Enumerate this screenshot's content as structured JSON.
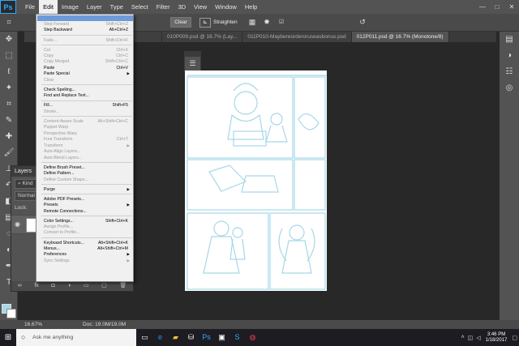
{
  "app": {
    "logo": "Ps"
  },
  "menubar": {
    "items": [
      "File",
      "Edit",
      "Image",
      "Layer",
      "Type",
      "Select",
      "Filter",
      "3D",
      "View",
      "Window",
      "Help"
    ],
    "active": "Edit",
    "window_controls": [
      "—",
      "□",
      "✕"
    ]
  },
  "options_bar": {
    "clear_label": "Clear",
    "straighten_label": "Straighten"
  },
  "tabs": [
    {
      "label": "010P009.psd @ 16.7% (Lay...",
      "active": false
    },
    {
      "label": "011P010-Maybereorderoruseasbonus.psd",
      "active": false
    },
    {
      "label": "012P011.psd @ 16.7% (Monotone/8)",
      "active": true
    }
  ],
  "edit_menu": {
    "items": [
      {
        "label": "",
        "shortcut": "",
        "disabled": false,
        "highlighted": true
      },
      {
        "label": "Step Forward",
        "shortcut": "Shift+Ctrl+Z",
        "disabled": true
      },
      {
        "label": "Step Backward",
        "shortcut": "Alt+Ctrl+Z",
        "disabled": false
      },
      {
        "sep": true
      },
      {
        "label": "Fade...",
        "shortcut": "Shift+Ctrl+F",
        "disabled": true
      },
      {
        "sep": true
      },
      {
        "label": "Cut",
        "shortcut": "Ctrl+X",
        "disabled": true
      },
      {
        "label": "Copy",
        "shortcut": "Ctrl+C",
        "disabled": true
      },
      {
        "label": "Copy Merged",
        "shortcut": "Shift+Ctrl+C",
        "disabled": true
      },
      {
        "label": "Paste",
        "shortcut": "Ctrl+V",
        "disabled": false
      },
      {
        "label": "Paste Special",
        "shortcut": "",
        "disabled": false,
        "submenu": true
      },
      {
        "label": "Clear",
        "shortcut": "",
        "disabled": true
      },
      {
        "sep": true
      },
      {
        "label": "Check Spelling...",
        "shortcut": "",
        "disabled": false
      },
      {
        "label": "Find and Replace Text...",
        "shortcut": "",
        "disabled": false
      },
      {
        "sep": true
      },
      {
        "label": "Fill...",
        "shortcut": "Shift+F5",
        "disabled": false
      },
      {
        "label": "Stroke...",
        "shortcut": "",
        "disabled": true
      },
      {
        "sep": true
      },
      {
        "label": "Content-Aware Scale",
        "shortcut": "Alt+Shift+Ctrl+C",
        "disabled": true
      },
      {
        "label": "Puppet Warp",
        "shortcut": "",
        "disabled": true
      },
      {
        "label": "Perspective Warp",
        "shortcut": "",
        "disabled": true
      },
      {
        "label": "Free Transform",
        "shortcut": "Ctrl+T",
        "disabled": true
      },
      {
        "label": "Transform",
        "shortcut": "",
        "disabled": true,
        "submenu": true
      },
      {
        "label": "Auto-Align Layers...",
        "shortcut": "",
        "disabled": true
      },
      {
        "label": "Auto-Blend Layers...",
        "shortcut": "",
        "disabled": true
      },
      {
        "sep": true
      },
      {
        "label": "Define Brush Preset...",
        "shortcut": "",
        "disabled": false
      },
      {
        "label": "Define Pattern...",
        "shortcut": "",
        "disabled": false
      },
      {
        "label": "Define Custom Shape...",
        "shortcut": "",
        "disabled": true
      },
      {
        "sep": true
      },
      {
        "label": "Purge",
        "shortcut": "",
        "disabled": false,
        "submenu": true
      },
      {
        "sep": true
      },
      {
        "label": "Adobe PDF Presets...",
        "shortcut": "",
        "disabled": false
      },
      {
        "label": "Presets",
        "shortcut": "",
        "disabled": false,
        "submenu": true
      },
      {
        "label": "Remote Connections...",
        "shortcut": "",
        "disabled": false
      },
      {
        "sep": true
      },
      {
        "label": "Color Settings...",
        "shortcut": "Shift+Ctrl+K",
        "disabled": false
      },
      {
        "label": "Assign Profile...",
        "shortcut": "",
        "disabled": true
      },
      {
        "label": "Convert to Profile...",
        "shortcut": "",
        "disabled": true
      },
      {
        "sep": true
      },
      {
        "label": "Keyboard Shortcuts...",
        "shortcut": "Alt+Shift+Ctrl+K",
        "disabled": false
      },
      {
        "label": "Menus...",
        "shortcut": "Alt+Shift+Ctrl+M",
        "disabled": false
      },
      {
        "label": "Preferences",
        "shortcut": "",
        "disabled": false,
        "submenu": true
      },
      {
        "label": "Sync Settings",
        "shortcut": "",
        "disabled": true,
        "submenu": true
      }
    ]
  },
  "layers_panel": {
    "title": "Layers",
    "kind_label": "Kind",
    "mode_label": "Normal",
    "lock_label": "Lock:"
  },
  "status_bar": {
    "zoom": "16.67%",
    "doc_info": "Doc: 19.0M/19.0M"
  },
  "taskbar": {
    "search_placeholder": "Ask me anything",
    "time": "3:46 PM",
    "date": "1/18/2017"
  },
  "colors": {
    "accent": "#6b9bd8",
    "sketch": "#a6d8e8"
  }
}
